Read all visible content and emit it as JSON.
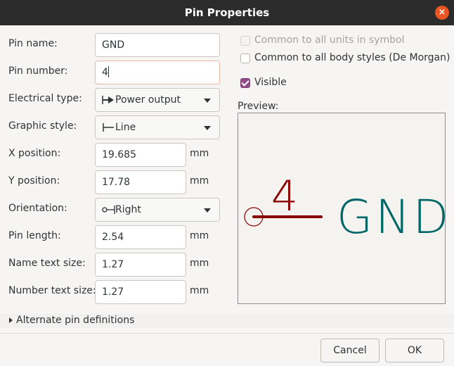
{
  "window": {
    "title": "Pin Properties",
    "close_symbol": "×"
  },
  "form": {
    "pin_name_label": "Pin name:",
    "pin_name_value": "GND",
    "pin_number_label": "Pin number:",
    "pin_number_value": "4",
    "electrical_type_label": "Electrical type:",
    "electrical_type_value": "Power output",
    "graphic_style_label": "Graphic style:",
    "graphic_style_value": "Line",
    "x_position_label": "X position:",
    "x_position_value": "19.685",
    "y_position_label": "Y position:",
    "y_position_value": "17.78",
    "orientation_label": "Orientation:",
    "orientation_value": "Right",
    "pin_length_label": "Pin length:",
    "pin_length_value": "2.54",
    "name_text_size_label": "Name text size:",
    "name_text_size_value": "1.27",
    "number_text_size_label": "Number text size:",
    "number_text_size_value": "1.27",
    "unit": "mm"
  },
  "options": {
    "common_units_label": "Common to all units in symbol",
    "common_units_checked": false,
    "common_units_enabled": false,
    "common_body_label": "Common to all body styles (De Morgan)",
    "common_body_checked": false,
    "visible_label": "Visible",
    "visible_checked": true
  },
  "preview": {
    "label": "Preview:",
    "pin_number_text": "4",
    "pin_name_text": "GND",
    "pin_color": "#8b0000",
    "name_color": "#006666"
  },
  "alternates": {
    "label": "Alternate pin definitions"
  },
  "buttons": {
    "cancel": "Cancel",
    "ok": "OK"
  },
  "colors": {
    "title_bar": "#2c2c2c",
    "close": "#e95420",
    "checkbox_on": "#924d8b"
  }
}
